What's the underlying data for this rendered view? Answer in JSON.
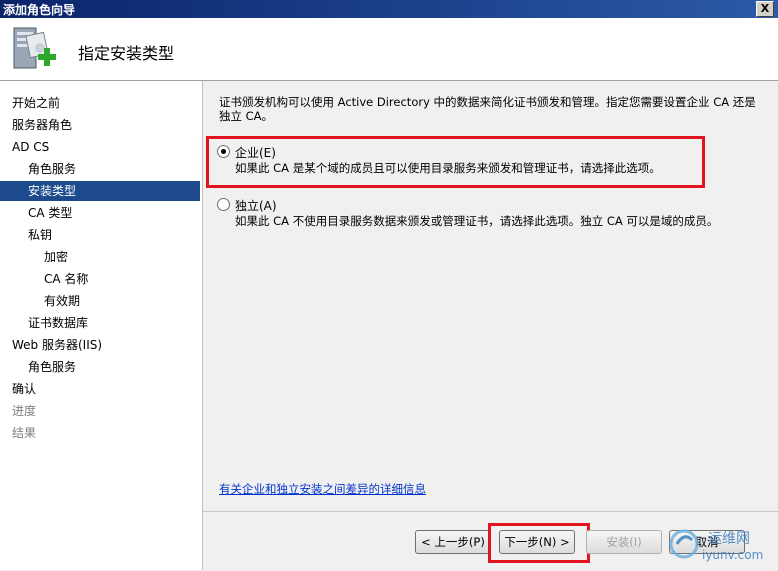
{
  "window": {
    "title": "添加角色向导",
    "close_glyph": "X"
  },
  "header": {
    "title": "指定安装类型"
  },
  "sidebar": {
    "items": [
      {
        "label": "开始之前",
        "level": 0,
        "state": "normal"
      },
      {
        "label": "服务器角色",
        "level": 0,
        "state": "normal"
      },
      {
        "label": "AD CS",
        "level": 0,
        "state": "normal"
      },
      {
        "label": "角色服务",
        "level": 1,
        "state": "normal"
      },
      {
        "label": "安装类型",
        "level": 1,
        "state": "selected"
      },
      {
        "label": "CA 类型",
        "level": 1,
        "state": "normal"
      },
      {
        "label": "私钥",
        "level": 1,
        "state": "normal"
      },
      {
        "label": "加密",
        "level": 2,
        "state": "normal"
      },
      {
        "label": "CA 名称",
        "level": 2,
        "state": "normal"
      },
      {
        "label": "有效期",
        "level": 2,
        "state": "normal"
      },
      {
        "label": "证书数据库",
        "level": 1,
        "state": "normal"
      },
      {
        "label": "Web 服务器(IIS)",
        "level": 0,
        "state": "normal"
      },
      {
        "label": "角色服务",
        "level": 1,
        "state": "normal"
      },
      {
        "label": "确认",
        "level": 0,
        "state": "normal"
      },
      {
        "label": "进度",
        "level": 0,
        "state": "disabled"
      },
      {
        "label": "结果",
        "level": 0,
        "state": "disabled"
      }
    ]
  },
  "main": {
    "intro": "证书颁发机构可以使用 Active Directory 中的数据来简化证书颁发和管理。指定您需要设置企业 CA 还是独立 CA。",
    "options": [
      {
        "label": "企业(E)",
        "description": "如果此 CA 是某个域的成员且可以使用目录服务来颁发和管理证书，请选择此选项。",
        "checked": true
      },
      {
        "label": "独立(A)",
        "description": "如果此 CA 不使用目录服务数据来颁发或管理证书，请选择此选项。独立 CA 可以是域的成员。",
        "checked": false
      }
    ],
    "link": "有关企业和独立安装之间差异的详细信息"
  },
  "footer": {
    "prev": "< 上一步(P)",
    "next": "下一步(N) >",
    "install": "安装(I)",
    "cancel": "取消"
  },
  "watermark": {
    "text1": "运维网",
    "text2": "iyunv.com"
  },
  "colors": {
    "highlight": "#e0151f",
    "selected": "#1c4a8c",
    "link": "#0033cc"
  }
}
